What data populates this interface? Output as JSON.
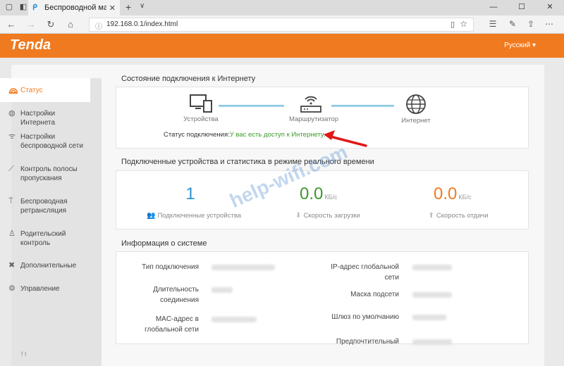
{
  "browser": {
    "tab_title": "Беспроводной маршру",
    "url": "192.168.0.1/index.html"
  },
  "header": {
    "logo": "Tenda",
    "language": "Русский"
  },
  "sidebar": {
    "items": [
      {
        "label": "Статус",
        "icon": "status-wave-icon"
      },
      {
        "label": "Настройки Интернета",
        "icon": "globe-icon"
      },
      {
        "label": "Настройки беспроводной сети",
        "icon": "wifi-icon"
      },
      {
        "label": "Контроль полосы пропускания",
        "icon": "chart-line-icon"
      },
      {
        "label": "Беспроводная ретрансляция",
        "icon": "repeater-icon"
      },
      {
        "label": "Родительский контроль",
        "icon": "person-icon"
      },
      {
        "label": "Дополнительные",
        "icon": "tools-icon"
      },
      {
        "label": "Управление",
        "icon": "gear-icon"
      }
    ],
    "social": "f  t"
  },
  "connection": {
    "title": "Состояние подключения к Интернету",
    "devices_label": "Устройства",
    "router_label": "Маршрутизатор",
    "internet_label": "Интернет",
    "status_prefix": "Статус подключения:",
    "status_value": "У вас есть доступ к Интернету."
  },
  "stats": {
    "title": "Подключенные устройства и статистика в режиме реального времени",
    "devices_count": "1",
    "devices_label": "Подключенные устройства",
    "download_value": "0.0",
    "download_unit": "КБ/с",
    "download_label": "Скорость загрузки",
    "upload_value": "0.0",
    "upload_unit": "КБ/с",
    "upload_label": "Скорость отдачи"
  },
  "system": {
    "title": "Информация о системе",
    "connection_type_label": "Тип подключения",
    "duration_label": "Длительность соединения",
    "mac_label": "MAC-адрес в глобальной сети",
    "ip_label": "IP-адрес глобальной сети",
    "mask_label": "Маска подсети",
    "gateway_label": "Шлюз по умолчанию",
    "dns_label": "Предпочтительный"
  },
  "watermark": "help-wifi.com",
  "colors": {
    "brand": "#f07a1f",
    "devices_count": "#2b94d6",
    "download": "#3c9a2a",
    "upload": "#f07a1f"
  }
}
